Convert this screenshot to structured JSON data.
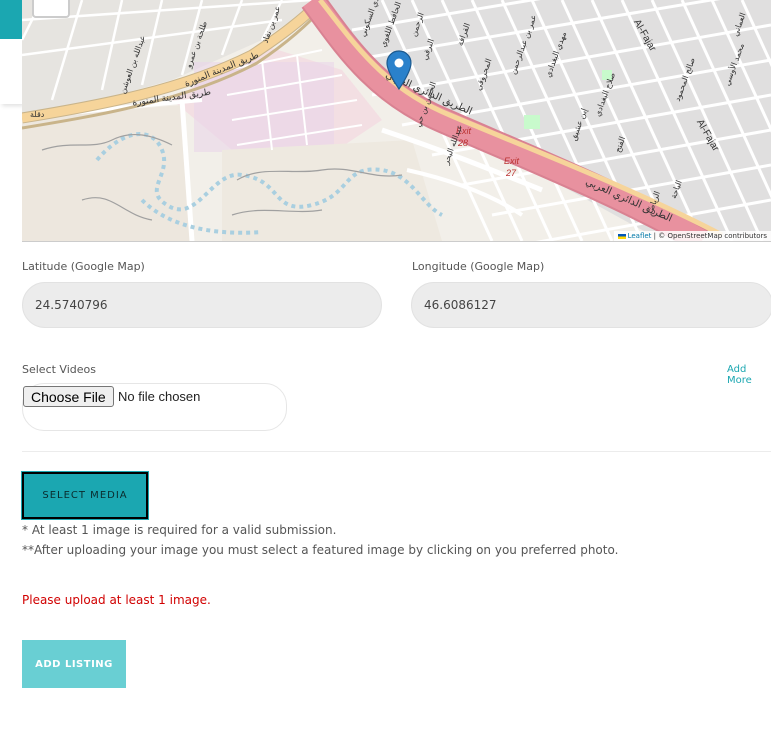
{
  "map": {
    "attribution_leaflet": "Leaflet",
    "attribution_osm": "| © OpenStreetMap contributors",
    "labels": [
      "طريق المدينة المنورة",
      "طريق المدينة المنورة",
      "الطريق الدائري العربي",
      "الطريق الدائري العربي",
      "Exit",
      "28",
      "Exit",
      "27",
      "Al-Fajar",
      "Al-Fajar",
      "دقلة",
      "عمر بن نفاذ",
      "طلحة بن عمرو",
      "عبدالله بن العوشن",
      "عدي السكوني",
      "الحافظ اللغوي",
      "الحسن بن حي",
      "القرافة",
      "البرقي",
      "المحروقي",
      "عبدالله البحر",
      "الرحمن",
      "عمر بن عبدالرحمن",
      "مهدي البغدادي",
      "صلاح البغدادي",
      "العماني",
      "صالح المحمود",
      "محمد الأوسي",
      "الباحة",
      "الرياض",
      "الفتح",
      "إبن عشيق"
    ]
  },
  "fields": {
    "latitude": {
      "label": "Latitude (Google Map)",
      "value": "24.5740796"
    },
    "longitude": {
      "label": "Longitude (Google Map)",
      "value": "46.6086127"
    }
  },
  "videos": {
    "label": "Select Videos",
    "add_more": "Add More",
    "choose_file": "Choose File",
    "no_file": "No file chosen"
  },
  "media": {
    "select_button": "SELECT MEDIA",
    "note1": "* At least 1 image is required for a valid submission.",
    "note2": "**After uploading your image you must select a featured image by clicking on you preferred photo."
  },
  "error": "Please upload at least 1 image.",
  "submit": "ADD LISTING",
  "colors": {
    "accent": "#1ba7b1",
    "accent_light": "#69cfd3",
    "error": "#d10000",
    "highway": "#e8919f",
    "road_orange": "#f6d49a",
    "marker": "#2a81cb"
  }
}
